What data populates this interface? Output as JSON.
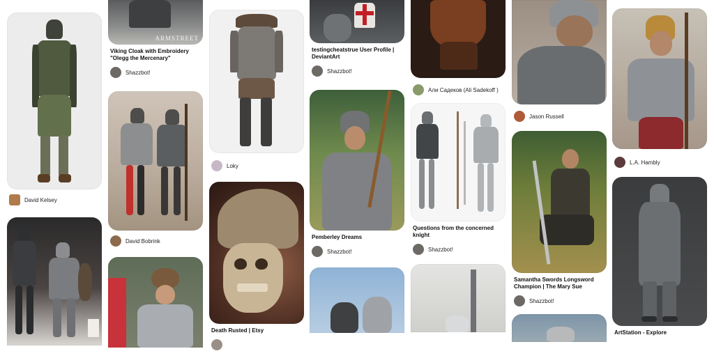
{
  "pins": {
    "p1": {
      "title": "",
      "user": "David Kelsey"
    },
    "p2": {
      "title": "",
      "user": ""
    },
    "p3": {
      "title": "Viking Cloak with Embroidery \"Olegg the Mercenary\"",
      "user": "Shazzbot!",
      "watermark": "ARMSTREET"
    },
    "p4": {
      "title": "",
      "user": "David Bobrink"
    },
    "p5": {
      "title": "",
      "user": ""
    },
    "p6": {
      "title": "",
      "user": "Loky"
    },
    "p7": {
      "title": "Death Rusted | Etsy",
      "user": ""
    },
    "p8": {
      "title": "testingcheatstrue User Profile | DeviantArt",
      "user": "Shazzbot!"
    },
    "p9": {
      "title": "Pemberley Dreams",
      "user": "Shazzbot!"
    },
    "p10": {
      "title": "",
      "user": ""
    },
    "p11": {
      "title": "",
      "user": "Али Садеков (Ali Sadekoff )"
    },
    "p12": {
      "title": "Questions from the concerned knight",
      "user": "Shazzbot!"
    },
    "p13": {
      "title": "",
      "user": ""
    },
    "p14": {
      "title": "",
      "user": "Jason Russell"
    },
    "p15": {
      "title": "Samantha Swords Longsword Champion | The Mary Sue",
      "user": "Shazzbot!"
    },
    "p16": {
      "title": "",
      "user": ""
    },
    "p17": {
      "title": "",
      "user": "L.A. Hambly"
    },
    "p18": {
      "title": "ArtStation - Explore",
      "user": ""
    }
  }
}
